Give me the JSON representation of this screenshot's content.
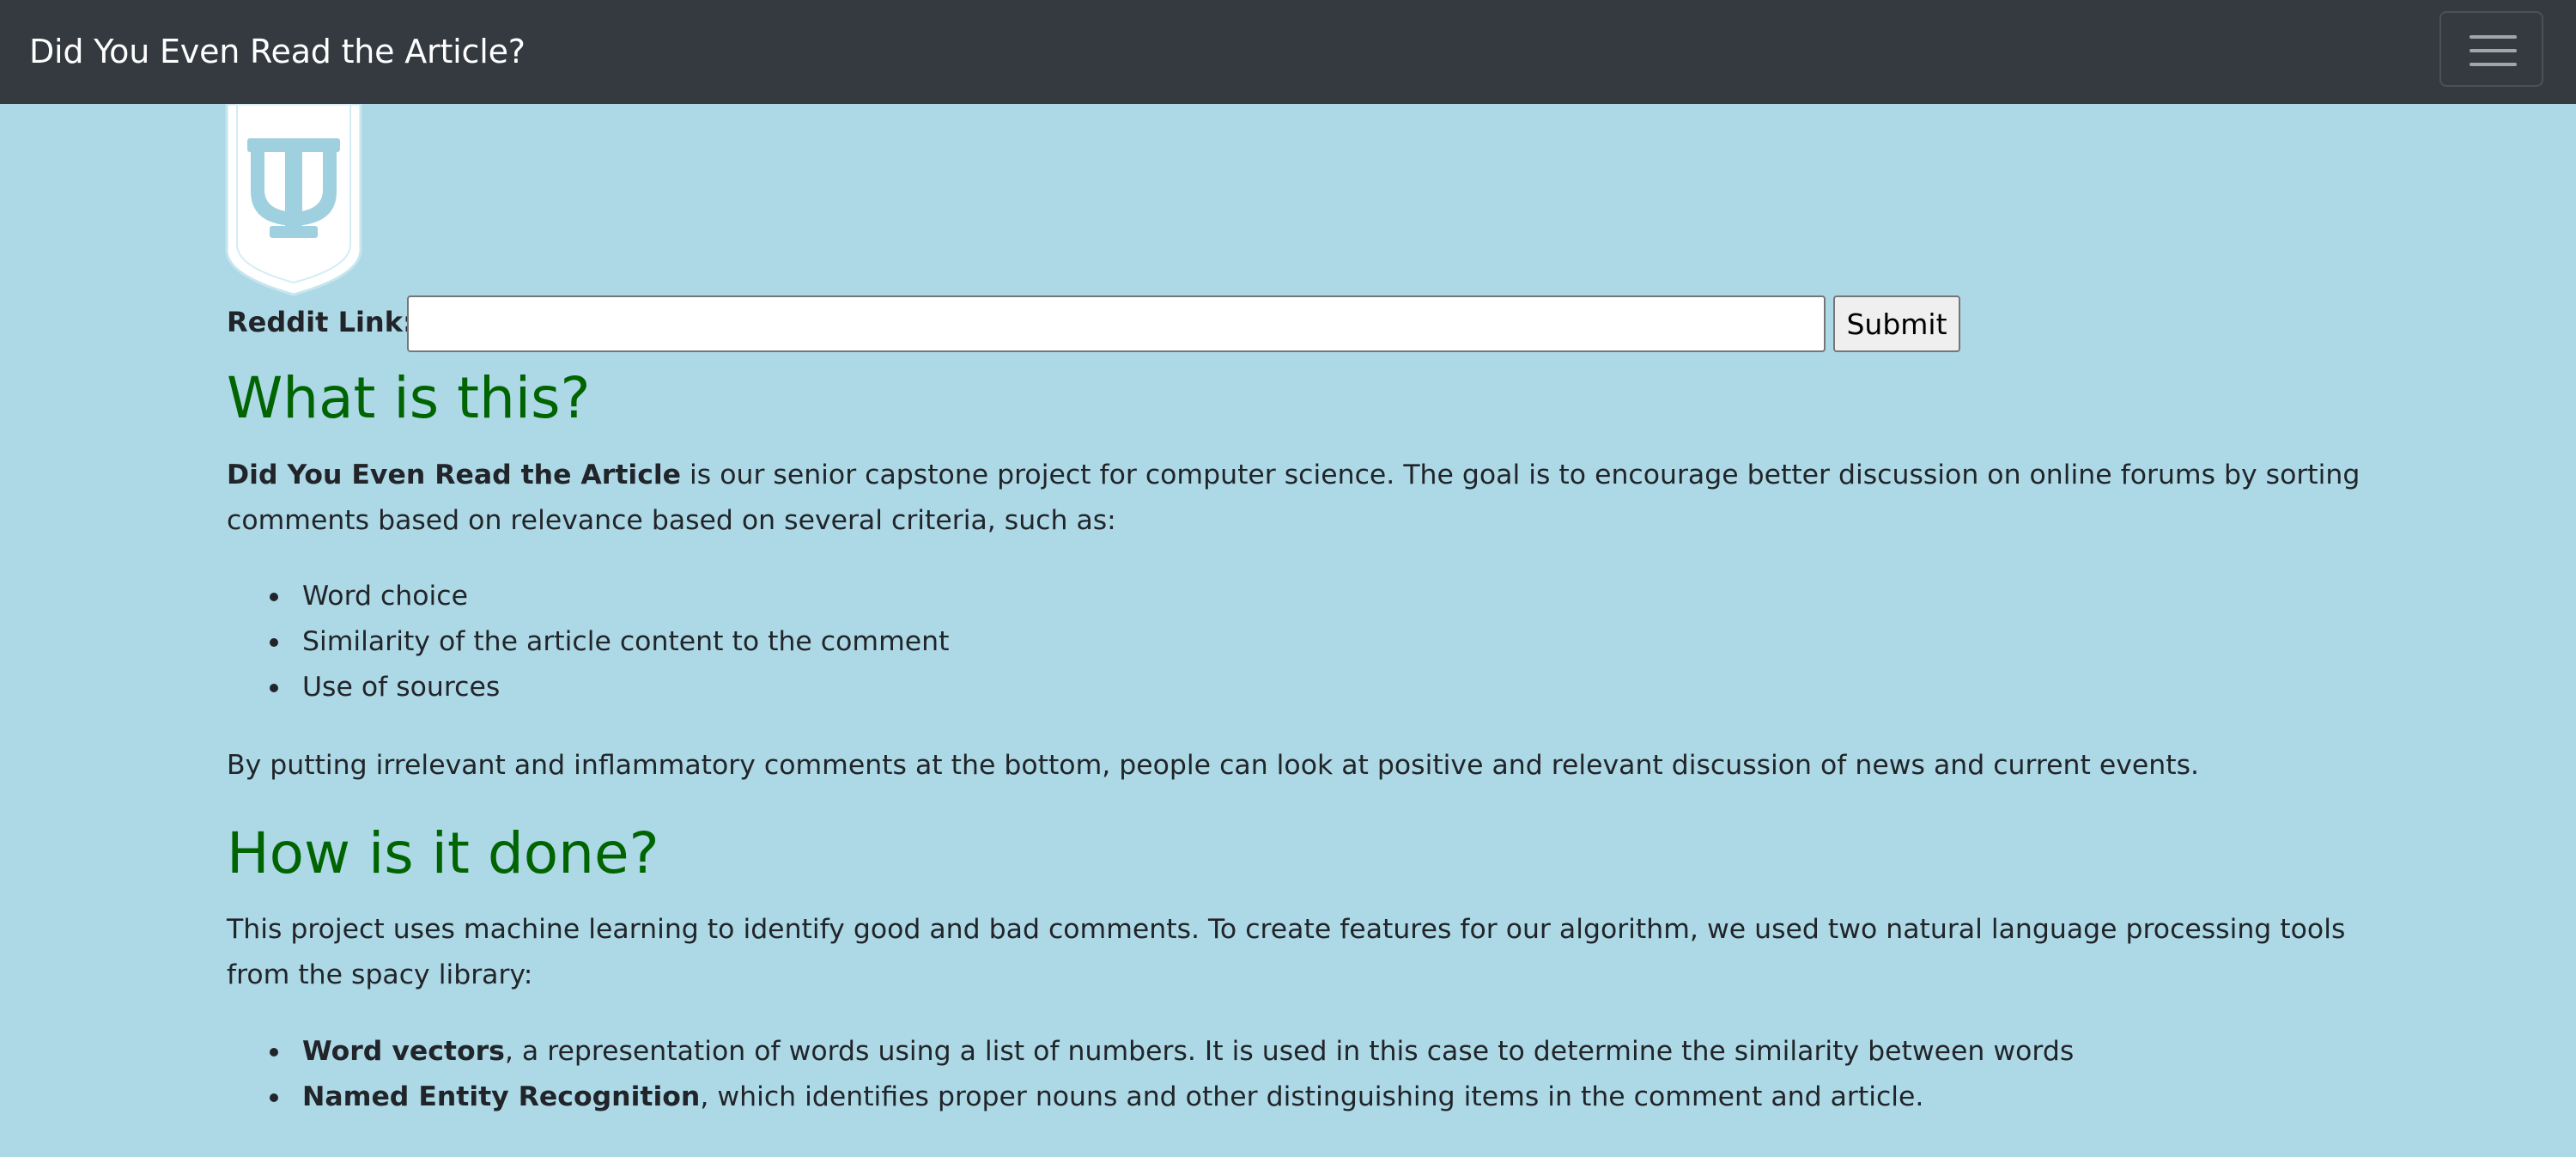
{
  "navbar": {
    "brand": "Did You Even Read the Article?",
    "toggle_icon": "hamburger-menu-icon"
  },
  "logo": {
    "icon": "shield-logo-icon",
    "colors": {
      "shield": "#ffffff",
      "monogram": "#9fd0df"
    }
  },
  "form": {
    "label": "Reddit Link:",
    "input_value": "",
    "input_placeholder": "",
    "submit_label": "Submit"
  },
  "section_what": {
    "heading": "What is this?",
    "intro_bold": "Did You Even Read the Article",
    "intro_text": " is our senior capstone project for computer science. The goal is to encourage better discussion on online forums by sorting comments based on relevance based on several criteria, such as:",
    "criteria": [
      "Word choice",
      "Similarity of the article content to the comment",
      "Use of sources"
    ],
    "closing": "By putting irrelevant and inflammatory comments at the bottom, people can look at positive and relevant discussion of news and current events."
  },
  "section_how": {
    "heading": "How is it done?",
    "intro": "This project uses machine learning to identify good and bad comments. To create features for our algorithm, we used two natural language processing tools from the spacy library:",
    "tools": [
      {
        "name": "Word vectors",
        "desc": ", a representation of words using a list of numbers. It is used in this case to determine the similarity between words"
      },
      {
        "name": "Named Entity Recognition",
        "desc": ", which identifies proper nouns and other distinguishing items in the comment and article."
      }
    ]
  },
  "colors": {
    "page_background": "#add8e6",
    "navbar_background": "#343a40",
    "heading_color": "#006400"
  }
}
